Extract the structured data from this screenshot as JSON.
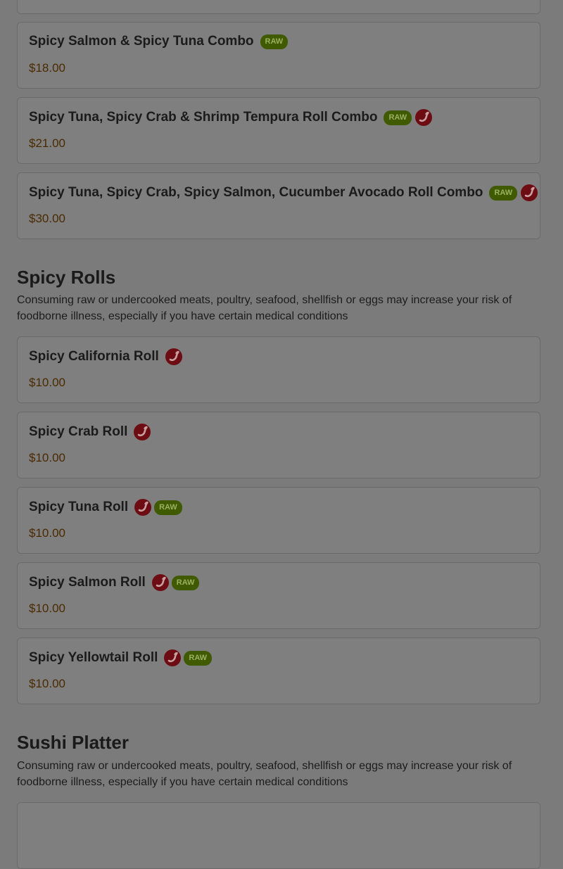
{
  "sections": [
    {
      "title": "",
      "items": [
        {
          "name": "Spicy Salmon & Spicy Tuna Combo",
          "price": "$18.00",
          "tags": [
            "raw"
          ]
        },
        {
          "name": "Spicy Tuna, Spicy Crab & Shrimp Tempura Roll Combo",
          "price": "$21.00",
          "tags": [
            "raw",
            "spicy"
          ]
        },
        {
          "name": "Spicy Tuna, Spicy Crab, Spicy Salmon, Cucumber Avocado Roll Combo",
          "price": "$30.00",
          "tags": [
            "raw",
            "spicy"
          ]
        }
      ]
    },
    {
      "title": "Spicy Rolls",
      "description": "Consuming raw or undercooked meats, poultry, seafood, shellfish or eggs may increase your risk of foodborne illness, especially if you have certain medical conditions",
      "items": [
        {
          "name": "Spicy California Roll",
          "price": "$10.00",
          "tags": [
            "spicy"
          ]
        },
        {
          "name": "Spicy Crab Roll",
          "price": "$10.00",
          "tags": [
            "spicy"
          ]
        },
        {
          "name": "Spicy Tuna Roll",
          "price": "$10.00",
          "tags": [
            "spicy",
            "raw"
          ]
        },
        {
          "name": "Spicy Salmon Roll",
          "price": "$10.00",
          "tags": [
            "spicy",
            "raw"
          ]
        },
        {
          "name": "Spicy Yellowtail Roll",
          "price": "$10.00",
          "tags": [
            "spicy",
            "raw"
          ]
        }
      ]
    },
    {
      "title": "Sushi Platter",
      "description": "Consuming raw or undercooked meats, poultry, seafood, shellfish or eggs may increase your risk of foodborne illness, especially if you have certain medical conditions",
      "items": []
    }
  ],
  "badges": {
    "raw_label": "RAW",
    "spicy_icon": "chili-pepper-icon"
  },
  "colors": {
    "raw_badge": "#3f5a00",
    "spicy_badge": "#6d0c12",
    "price": "#4a2a00",
    "overlay": "#7b7b7b"
  }
}
